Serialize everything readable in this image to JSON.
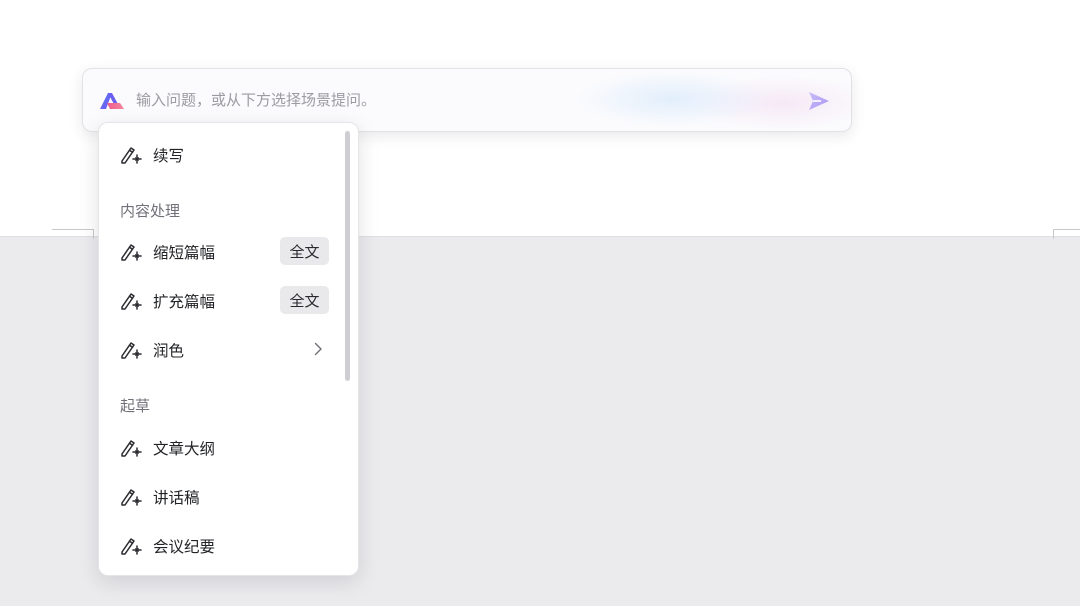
{
  "prompt": {
    "placeholder": "输入问题，或从下方选择场景提问。"
  },
  "menu": {
    "top_item": {
      "label": "续写",
      "icon": "magic-pen-icon"
    },
    "sections": [
      {
        "title": "内容处理",
        "items": [
          {
            "label": "缩短篇幅",
            "tag": "全文",
            "icon": "magic-pen-icon"
          },
          {
            "label": "扩充篇幅",
            "tag": "全文",
            "icon": "magic-pen-icon"
          },
          {
            "label": "润色",
            "submenu_icon": "chevron-right-icon",
            "icon": "magic-pen-icon"
          }
        ]
      },
      {
        "title": "起草",
        "items": [
          {
            "label": "文章大纲",
            "icon": "magic-pen-icon"
          },
          {
            "label": "讲话稿",
            "icon": "magic-pen-icon"
          },
          {
            "label": "会议纪要",
            "icon": "magic-pen-icon"
          }
        ]
      }
    ]
  },
  "colors": {
    "accent_purple": "#8b7cf6",
    "logo_pink": "#ef5a8c",
    "logo_blue": "#5a6cf0",
    "workspace_bg": "#ebebed"
  }
}
